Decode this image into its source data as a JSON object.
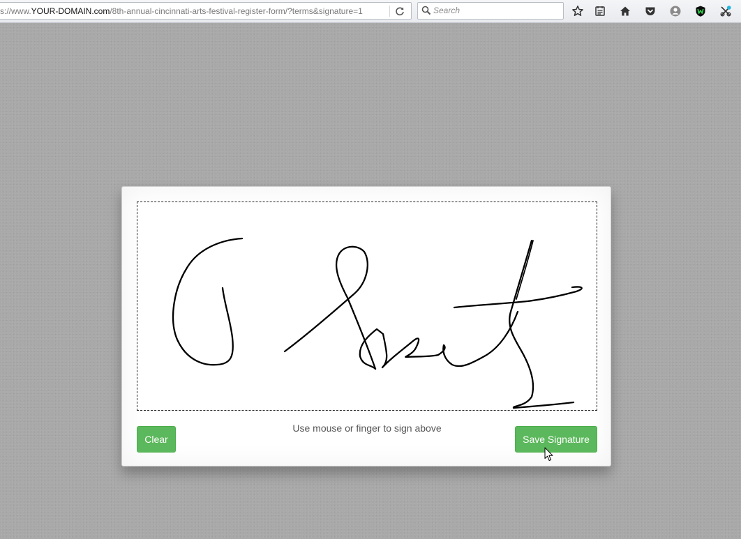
{
  "browser": {
    "url_prefix": "s://www.",
    "url_domain": "YOUR-DOMAIN.com",
    "url_path": "/8th-annual-cincinnati-arts-festival-register-form/?terms&signature=1",
    "search_placeholder": "Search",
    "icons": [
      "reload-icon",
      "search-icon",
      "bookmark-star-icon",
      "reading-list-icon",
      "home-icon",
      "pocket-icon",
      "account-icon",
      "shield-w-icon",
      "extensions-icon"
    ]
  },
  "signature_dialog": {
    "hint": "Use mouse or finger to sign above",
    "clear_label": "Clear",
    "save_label": "Save Signature"
  },
  "colors": {
    "page_background": "#a9a9a9",
    "button_green": "#5cb85c",
    "ink": "#000000"
  }
}
